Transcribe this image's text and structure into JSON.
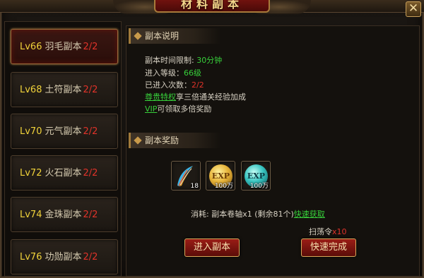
{
  "window": {
    "title": "材料副本",
    "close_glyph": "✕"
  },
  "levels": [
    {
      "lv": "Lv66",
      "name": "羽毛副本",
      "count": "2/2",
      "selected": true
    },
    {
      "lv": "Lv68",
      "name": "土符副本",
      "count": "2/2",
      "selected": false
    },
    {
      "lv": "Lv70",
      "name": "元气副本",
      "count": "2/2",
      "selected": false
    },
    {
      "lv": "Lv72",
      "name": "火石副本",
      "count": "2/2",
      "selected": false
    },
    {
      "lv": "Lv74",
      "name": "金珠副本",
      "count": "2/2",
      "selected": false
    },
    {
      "lv": "Lv76",
      "name": "功勋副本",
      "count": "2/2",
      "selected": false
    }
  ],
  "description": {
    "header": "副本说明",
    "time_limit_label": "副本时间限制:",
    "time_limit_value": "30分钟",
    "level_label": "进入等级：",
    "level_value": "66级",
    "entries_label": "已进入次数：",
    "entries_value": "2/2",
    "privilege_link": "尊贵特权",
    "privilege_text": "享三倍通关经验加成",
    "vip_link": "VIP",
    "vip_text": "可领取多倍奖励"
  },
  "rewards": {
    "header": "副本奖励",
    "items": [
      {
        "icon": "feather-icon",
        "qty": "18"
      },
      {
        "icon": "exp-gold-icon",
        "label": "EXP",
        "qty": "100万"
      },
      {
        "icon": "exp-teal-icon",
        "label": "EXP",
        "qty": "100万"
      }
    ]
  },
  "cost": {
    "text": "消耗: 副本卷轴x1 (剩余81个)",
    "quick_get": "快速获取"
  },
  "sweep": {
    "label": "扫荡令",
    "value": "x10"
  },
  "buttons": {
    "enter": "进入副本",
    "quick_finish": "快速完成"
  },
  "colors": {
    "accent_gold": "#f0d23a",
    "count_red": "#e0332a",
    "link_green": "#37d03a"
  }
}
